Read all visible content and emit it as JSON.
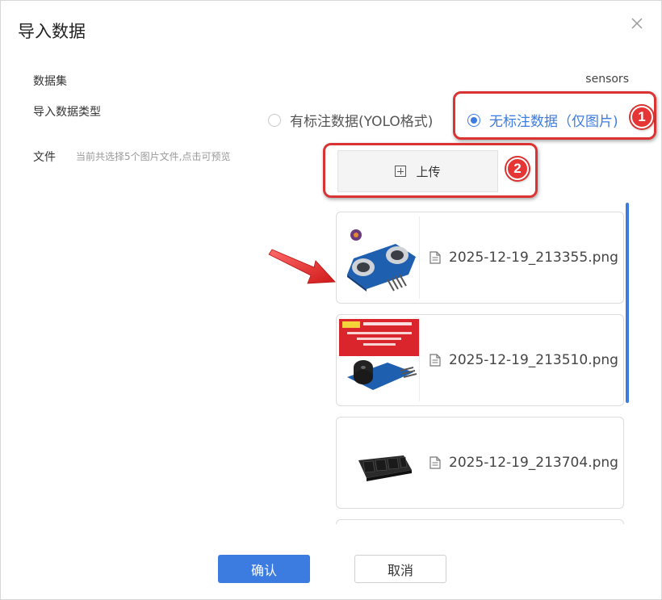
{
  "dialog": {
    "title": "导入数据",
    "close_icon": "close-icon"
  },
  "form": {
    "dataset_label": "数据集",
    "dataset_value": "sensors",
    "type_label": "导入数据类型",
    "type_options": [
      {
        "label": "有标注数据(YOLO格式)",
        "checked": false
      },
      {
        "label": "无标注数据（仅图片)",
        "checked": true
      }
    ],
    "file_label": "文件",
    "file_hint": "当前共选择5个图片文件,点击可预览",
    "upload_label": "上传",
    "upload_icon": "plus-square-icon"
  },
  "files": [
    {
      "name": "2025-12-19_213355.png",
      "icon": "file-icon"
    },
    {
      "name": "2025-12-19_213510.png",
      "icon": "file-icon"
    },
    {
      "name": "2025-12-19_213704.png",
      "icon": "file-icon"
    }
  ],
  "annotations": {
    "badge_1": "1",
    "badge_2": "2",
    "color": "#d93333"
  },
  "footer": {
    "confirm_label": "确认",
    "cancel_label": "取消"
  },
  "colors": {
    "accent": "#3c7be0"
  }
}
